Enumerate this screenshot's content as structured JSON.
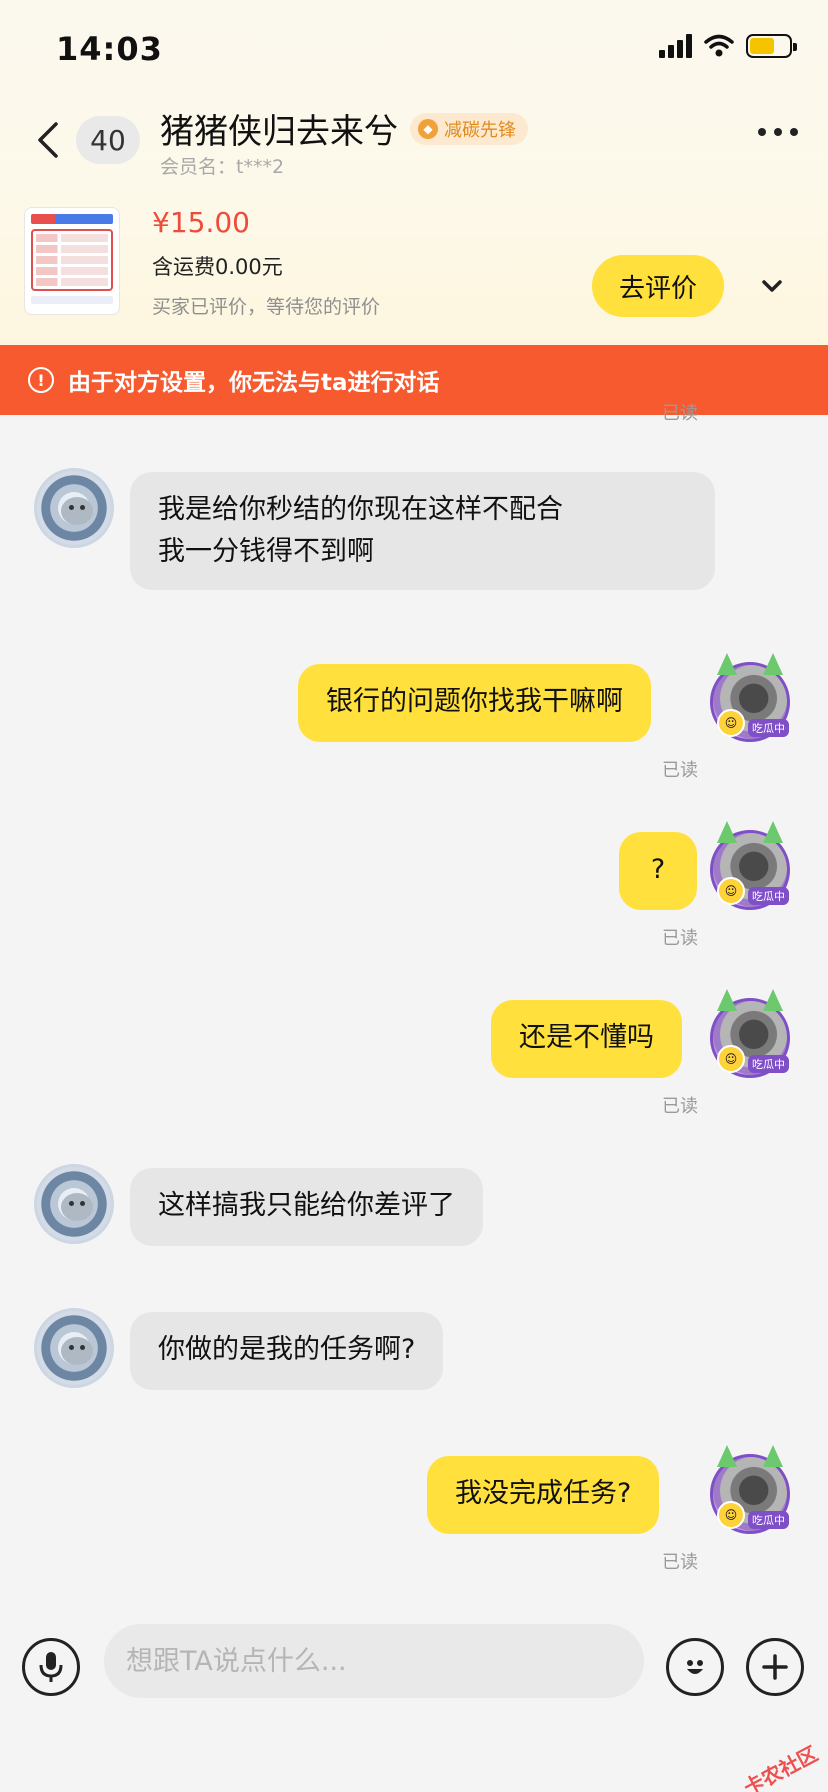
{
  "status_bar": {
    "time": "14:03"
  },
  "header": {
    "unread_count": "40",
    "title": "猪猪侠归去来兮",
    "tag_label": "减碳先锋",
    "member_name": "会员名：t***2"
  },
  "order": {
    "price": "¥15.00",
    "shipping": "含运费0.00元",
    "evaluation_note": "买家已评价，等待您的评价",
    "evaluate_button": "去评价"
  },
  "warning": {
    "text": "由于对方设置，你无法与ta进行对话"
  },
  "messages": [
    {
      "side": "in",
      "text": "我是给你秒结的你现在这样不配合\n我一分钱得不到啊"
    },
    {
      "side": "out",
      "text": "银行的问题你找我干嘛啊",
      "status": "已读"
    },
    {
      "side": "out",
      "text": "?",
      "status": "已读"
    },
    {
      "side": "out",
      "text": "还是不懂吗",
      "status": "已读"
    },
    {
      "side": "in",
      "text": "这样搞我只能给你差评了"
    },
    {
      "side": "in",
      "text": "你做的是我的任务啊?"
    },
    {
      "side": "out",
      "text": "我没完成任务?",
      "status": "已读"
    }
  ],
  "avatar_badge": "吃瓜中",
  "input": {
    "placeholder": "想跟TA说点什么..."
  },
  "watermark": "卡农社区",
  "colors": {
    "accent_yellow": "#ffe03c",
    "warning_orange": "#f85a2f",
    "price_red": "#ef4b3b",
    "tag_orange": "#e08b1c"
  },
  "icons": [
    "back-icon",
    "more-icon",
    "chevron-down-icon",
    "warning-icon",
    "microphone-icon",
    "emoji-icon",
    "plus-icon"
  ]
}
